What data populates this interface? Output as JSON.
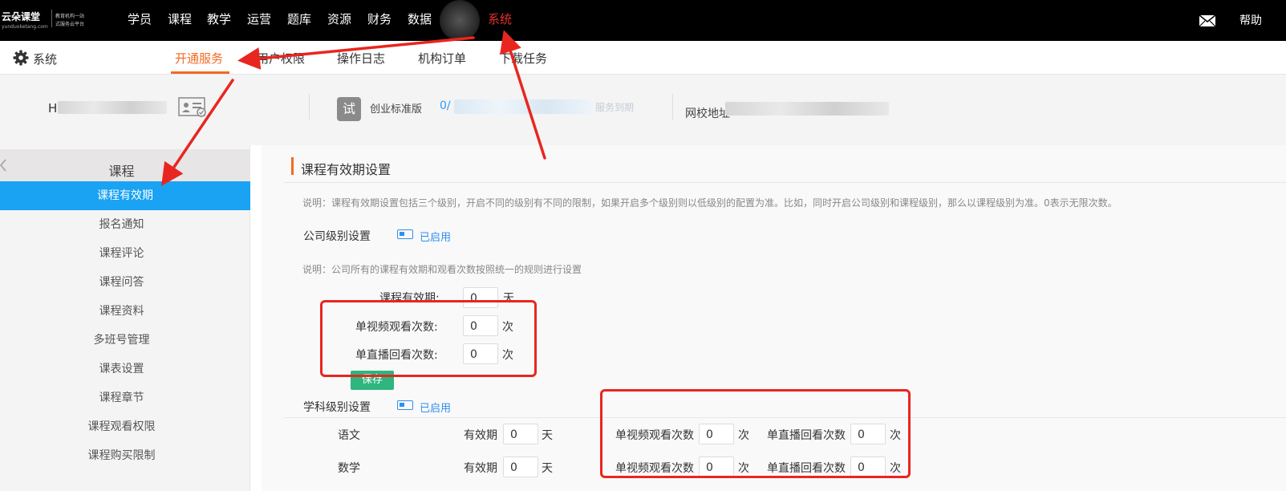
{
  "logo": {
    "brand": "云朵课堂",
    "domain": "yunduoketang.com",
    "tagline_1": "教育机构一站",
    "tagline_2": "式服务云平台"
  },
  "top_nav": {
    "items": [
      "学员",
      "课程",
      "教学",
      "运营",
      "题库",
      "资源",
      "财务",
      "数据",
      "系统"
    ],
    "active": "系统",
    "help": "帮助"
  },
  "sub_nav": {
    "section": "系统",
    "tabs": [
      "开通服务",
      "用户权限",
      "操作日志",
      "机构订单",
      "下载任务"
    ],
    "active": "开通服务"
  },
  "info_bar": {
    "org_initial": "H",
    "trial_badge": "试",
    "edition": "创业标准版",
    "quota_prefix": "0/",
    "service_expire": "服务到期",
    "school_url_label": "网校地址"
  },
  "sidebar": {
    "title": "课程",
    "items": [
      "课程有效期",
      "报名通知",
      "课程评论",
      "课程问答",
      "课程资料",
      "多班号管理",
      "课表设置",
      "课程章节",
      "课程观看权限",
      "课程购买限制"
    ],
    "active": "课程有效期"
  },
  "main": {
    "title": "课程有效期设置",
    "note": "说明：课程有效期设置包括三个级别，开启不同的级别有不同的限制，如果开启多个级别则以低级别的配置为准。比如，同时开启公司级别和课程级别，那么以课程级别为准。0表示无限次数。",
    "company": {
      "label": "公司级别设置",
      "status": "已启用",
      "note": "说明：公司所有的课程有效期和观看次数按照统一的规则进行设置",
      "validity_label": "课程有效期:",
      "validity_value": "0",
      "validity_unit": "天",
      "video_views_label": "单视频观看次数:",
      "video_views_value": "0",
      "video_views_unit": "次",
      "replay_views_label": "单直播回看次数:",
      "replay_views_value": "0",
      "replay_views_unit": "次",
      "save": "保存"
    },
    "subject": {
      "label": "学科级别设置",
      "status": "已启用",
      "validity_label": "有效期",
      "validity_unit": "天",
      "video_label": "单视频观看次数",
      "replay_label": "单直播回看次数",
      "count_unit": "次",
      "rows": [
        {
          "name": "语文",
          "validity": "0",
          "video": "0",
          "replay": "0"
        },
        {
          "name": "数学",
          "validity": "0",
          "video": "0",
          "replay": "0"
        }
      ]
    }
  },
  "colors": {
    "accent_orange": "#f26a22",
    "nav_active_red": "#e6302a",
    "sidebar_active_blue": "#1aa2f3",
    "toggle_blue": "#2f8ff0",
    "save_green": "#2fb57e",
    "annotation_red": "#e8261f"
  },
  "icons": [
    "gear-icon",
    "mail-icon",
    "id-card-icon",
    "chevron-left-icon",
    "toggle-icon"
  ]
}
